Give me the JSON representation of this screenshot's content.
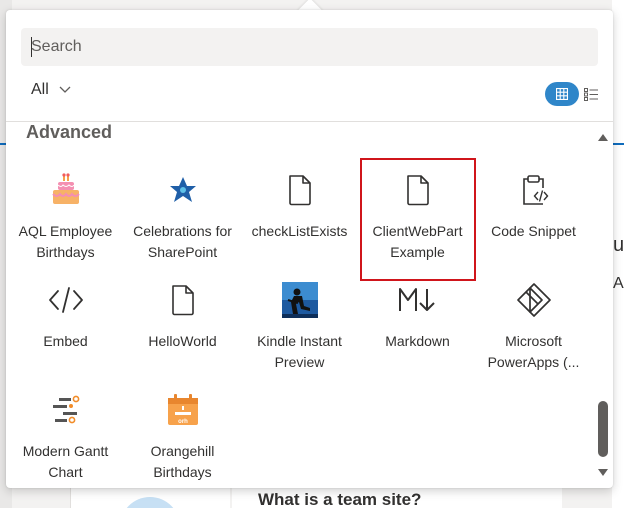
{
  "search": {
    "placeholder": "Search",
    "value": ""
  },
  "filter": {
    "selected": "All"
  },
  "view": {
    "active": "grid"
  },
  "section": {
    "title": "Advanced"
  },
  "tiles": [
    {
      "label": "AQL Employee Birthdays",
      "icon": "birthday-cake-icon"
    },
    {
      "label": "Celebrations for SharePoint",
      "icon": "star-badge-icon"
    },
    {
      "label": "checkListExists",
      "icon": "document-icon"
    },
    {
      "label": "ClientWebPart Example",
      "icon": "document-icon",
      "selected": true
    },
    {
      "label": "Code Snippet",
      "icon": "clipboard-code-icon"
    },
    {
      "label": "Embed",
      "icon": "code-brackets-icon"
    },
    {
      "label": "HelloWorld",
      "icon": "document-icon"
    },
    {
      "label": "Kindle Instant Preview",
      "icon": "kindle-icon"
    },
    {
      "label": "Markdown",
      "icon": "markdown-icon"
    },
    {
      "label": "Microsoft PowerApps (...",
      "icon": "powerapps-icon"
    },
    {
      "label": "Modern Gantt Chart",
      "icon": "gantt-icon"
    },
    {
      "label": "Orangehill Birthdays",
      "icon": "calendar-cake-icon"
    }
  ],
  "background": {
    "heading": "What is a team site?",
    "side_chars": [
      "u",
      "A"
    ]
  },
  "colors": {
    "accent": "#2f86c9",
    "selection": "#d0151b"
  }
}
